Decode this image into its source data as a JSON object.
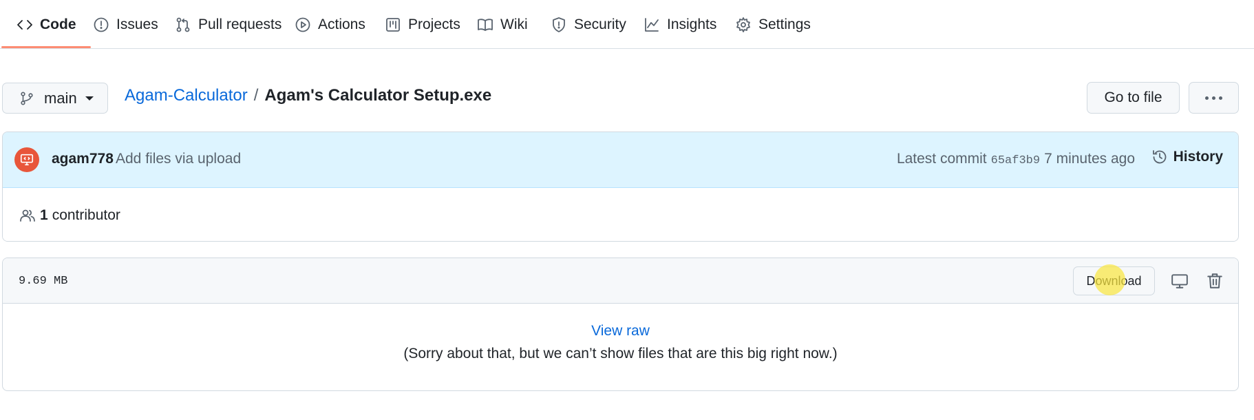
{
  "nav": {
    "tabs": [
      {
        "label": "Code",
        "icon": "code-icon",
        "active": true
      },
      {
        "label": "Issues",
        "icon": "issue-icon"
      },
      {
        "label": "Pull requests",
        "icon": "pull-request-icon"
      },
      {
        "label": "Actions",
        "icon": "play-icon"
      },
      {
        "label": "Projects",
        "icon": "project-board-icon"
      },
      {
        "label": "Wiki",
        "icon": "book-icon"
      },
      {
        "label": "Security",
        "icon": "shield-icon"
      },
      {
        "label": "Insights",
        "icon": "graph-icon"
      },
      {
        "label": "Settings",
        "icon": "gear-icon"
      }
    ]
  },
  "branch": {
    "name": "main"
  },
  "breadcrumb": {
    "repo": "Agam-Calculator",
    "separator": "/",
    "file": "Agam's Calculator Setup.exe"
  },
  "actions": {
    "goto_file": "Go to file"
  },
  "commit": {
    "author": "agam778",
    "message": "Add files via upload",
    "latest_label": "Latest commit",
    "sha": "65af3b9",
    "time": "7 minutes ago",
    "history_label": "History"
  },
  "contributors": {
    "count": "1",
    "label": "contributor"
  },
  "file": {
    "size": "9.69 MB",
    "download_label": "Download",
    "view_raw": "View raw",
    "too_big_message": "(Sorry about that, but we can’t show files that are this big right now.)"
  },
  "colors": {
    "accent_underline": "#fd8c73",
    "link": "#0969da",
    "commit_bg": "#ddf4ff",
    "avatar": "#e8563a"
  }
}
